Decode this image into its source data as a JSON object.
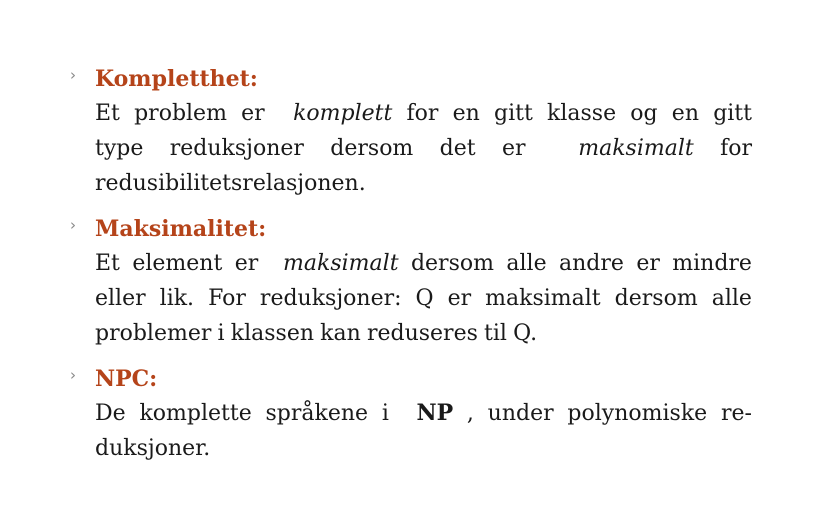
{
  "colors": {
    "heading": "#b5441a",
    "bullet": "#888888"
  },
  "bullet_icon": "chevron-right-icon",
  "items": [
    {
      "term": "Kompletthet:",
      "lines": [
        [
          {
            "t": "Et problem er "
          },
          {
            "t": "komplett",
            "i": true
          },
          {
            "t": " for en gitt klasse og en gitt"
          }
        ],
        [
          {
            "t": "type reduksjoner dersom det er "
          },
          {
            "t": "maksimalt",
            "i": true
          },
          {
            "t": " for"
          }
        ],
        [
          {
            "t": "redusibilitetsrelasjonen."
          }
        ]
      ]
    },
    {
      "term": "Maksimalitet:",
      "lines": [
        [
          {
            "t": "Et element er "
          },
          {
            "t": "maksimalt",
            "i": true
          },
          {
            "t": " dersom alle andre er mindre"
          }
        ],
        [
          {
            "t": "eller lik. For reduksjoner: Q er maksimalt dersom alle"
          }
        ],
        [
          {
            "t": "problemer i klassen kan reduseres til Q."
          }
        ]
      ]
    },
    {
      "term": "NPC:",
      "lines": [
        [
          {
            "t": "De komplette språkene i "
          },
          {
            "t": "NP",
            "b": true
          },
          {
            "t": ", under polynomiske re-"
          }
        ],
        [
          {
            "t": "duksjoner."
          }
        ]
      ]
    }
  ]
}
